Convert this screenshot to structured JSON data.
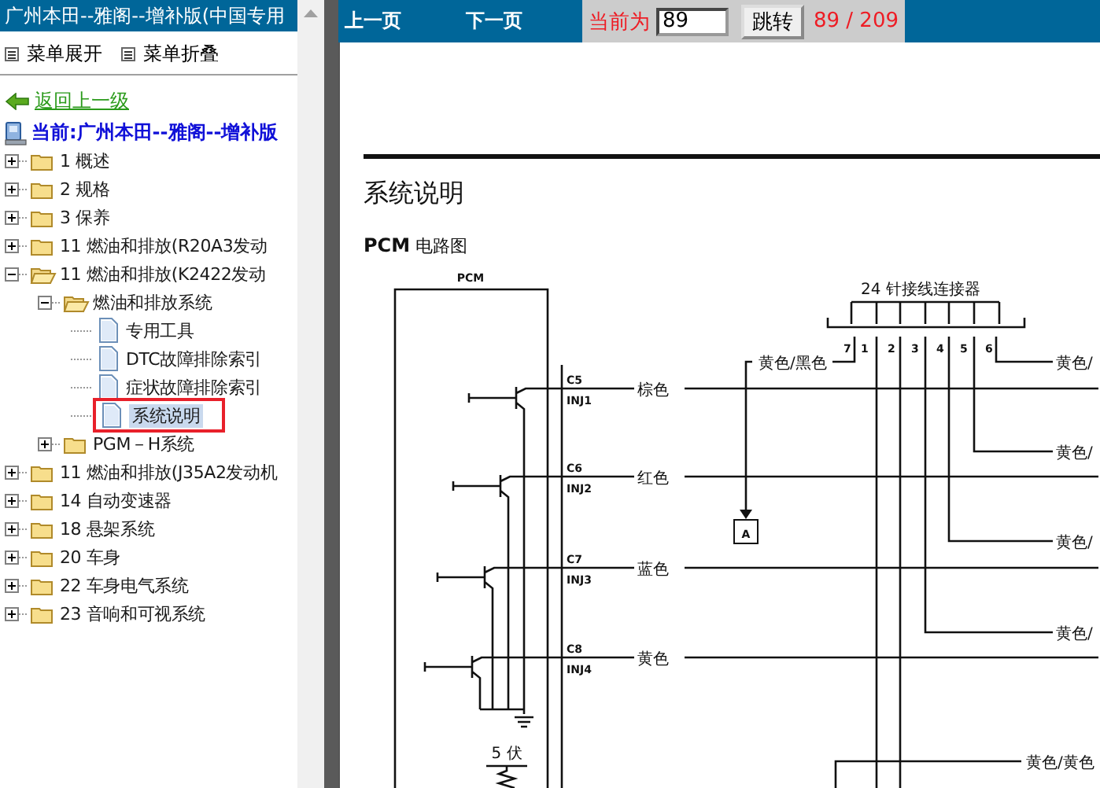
{
  "sidebar": {
    "title": "广州本田--雅阁--增补版(中国专用",
    "menu_actions": [
      "菜单展开",
      "菜单折叠"
    ],
    "back_link": "返回上一级",
    "current_path": "当前:广州本田--雅阁--增补版",
    "tree": [
      {
        "label": "1 概述",
        "kind": "folder",
        "expanded": false,
        "selected": false
      },
      {
        "label": "2 规格",
        "kind": "folder",
        "expanded": false,
        "selected": false
      },
      {
        "label": "3 保养",
        "kind": "folder",
        "expanded": false,
        "selected": false
      },
      {
        "label": "11 燃油和排放(R20A3发动",
        "kind": "folder",
        "expanded": false,
        "selected": false
      },
      {
        "label": "11 燃油和排放(K2422发动",
        "kind": "folder",
        "expanded": true,
        "selected": false,
        "children": [
          {
            "label": "燃油和排放系统",
            "kind": "folder",
            "expanded": true,
            "selected": false,
            "children": [
              {
                "label": "专用工具",
                "kind": "page",
                "selected": false
              },
              {
                "label": "DTC故障排除索引",
                "kind": "page",
                "selected": false
              },
              {
                "label": "症状故障排除索引",
                "kind": "page",
                "selected": false
              },
              {
                "label": "系统说明",
                "kind": "page",
                "selected": true
              }
            ]
          },
          {
            "label": "PGM－H系统",
            "kind": "folder",
            "expanded": false,
            "selected": false
          }
        ]
      },
      {
        "label": "11 燃油和排放(J35A2发动机",
        "kind": "folder",
        "expanded": false,
        "selected": false
      },
      {
        "label": "14 自动变速器",
        "kind": "folder",
        "expanded": false,
        "selected": false
      },
      {
        "label": "18 悬架系统",
        "kind": "folder",
        "expanded": false,
        "selected": false
      },
      {
        "label": "20 车身",
        "kind": "folder",
        "expanded": false,
        "selected": false
      },
      {
        "label": "22 车身电气系统",
        "kind": "folder",
        "expanded": false,
        "selected": false
      },
      {
        "label": "23 音响和可视系统",
        "kind": "folder",
        "expanded": false,
        "selected": false
      }
    ]
  },
  "toolbar": {
    "prev": "上一页",
    "next": "下一页",
    "page_label": "当前为",
    "page_input": "89",
    "go_button": "跳转",
    "page_count": "89 / 209"
  },
  "document": {
    "heading": "系统说明",
    "subheading": "**PCM** 电路图",
    "diagram": {
      "module": "PCM",
      "connector": "24 针接线连接器",
      "pins": [
        "7",
        "1",
        "2",
        "3",
        "4",
        "5",
        "6"
      ],
      "injectors": [
        {
          "terminal": "C5",
          "signal": "INJ1",
          "wire": "棕色"
        },
        {
          "terminal": "C6",
          "signal": "INJ2",
          "wire": "红色"
        },
        {
          "terminal": "C7",
          "signal": "INJ3",
          "wire": "蓝色"
        },
        {
          "terminal": "C8",
          "signal": "INJ4",
          "wire": "黄色"
        }
      ],
      "left_wire": "黄色/黑色",
      "right_wires": [
        "黄色/",
        "黄色/",
        "黄色/",
        "黄色/"
      ],
      "bottom_wire": "黄色/黄色",
      "marker": "A",
      "voltage": "5 伏"
    }
  }
}
